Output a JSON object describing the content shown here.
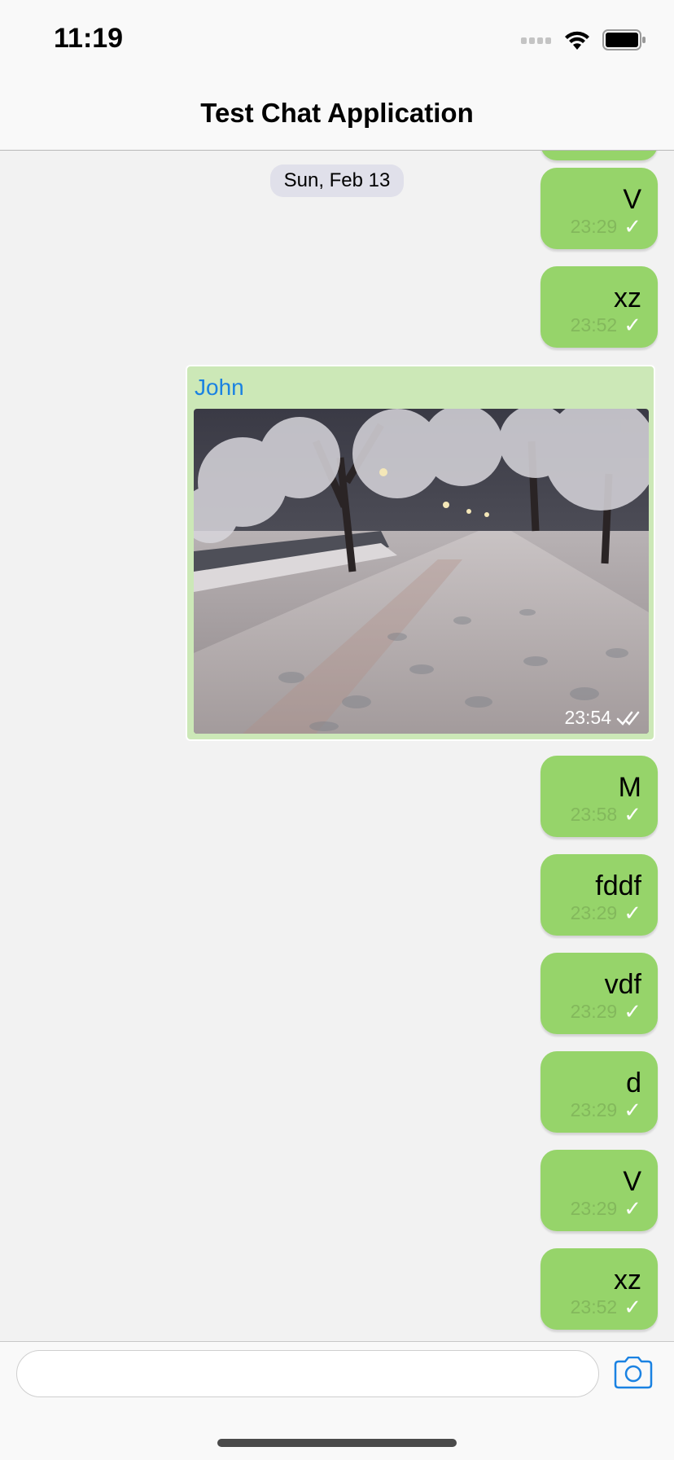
{
  "status_bar": {
    "time": "11:19"
  },
  "nav": {
    "title": "Test Chat Application"
  },
  "date_separator": "Sun, Feb 13",
  "messages": [
    {
      "text": "V",
      "time": "23:29"
    },
    {
      "text": "xz",
      "time": "23:52"
    },
    {
      "sender": "John",
      "time": "23:54",
      "image": "snowy-night-street-photo"
    },
    {
      "text": "M",
      "time": "23:58"
    },
    {
      "text": "fddf",
      "time": "23:29"
    },
    {
      "text": "vdf",
      "time": "23:29"
    },
    {
      "text": "d",
      "time": "23:29"
    },
    {
      "text": "V",
      "time": "23:29"
    },
    {
      "text": "xz",
      "time": "23:52"
    }
  ],
  "composer": {
    "placeholder": ""
  },
  "colors": {
    "outgoing_bubble": "#96d46a",
    "media_bubble": "#cce8b7",
    "sender_name": "#1a82e2",
    "accent": "#1a82e2"
  },
  "icons": {
    "send_media": "camera-icon",
    "read_receipt": "checkmark-icon",
    "delivered_receipt": "double-checkmark-icon"
  }
}
